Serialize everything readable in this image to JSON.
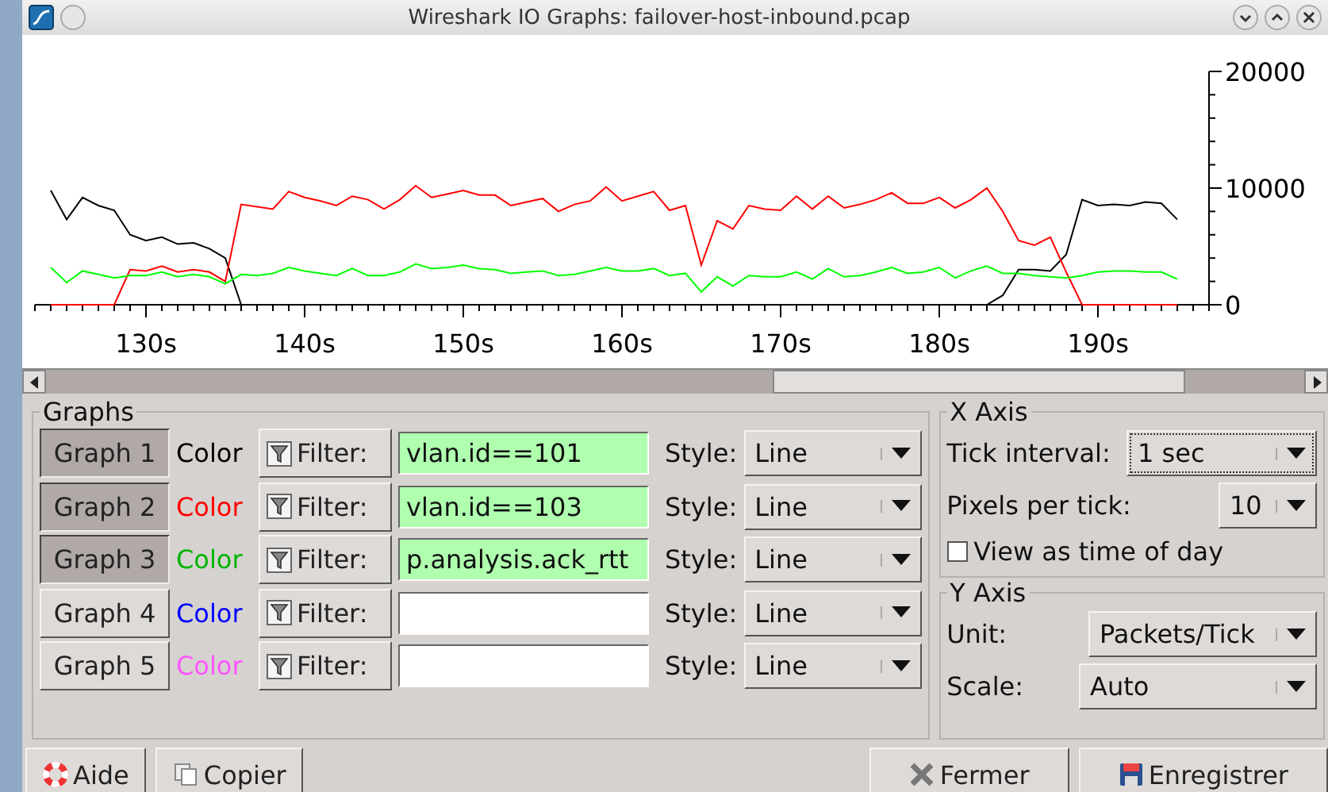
{
  "window": {
    "title": "Wireshark IO Graphs: failover-host-inbound.pcap"
  },
  "plot": {
    "chart_data": {
      "type": "line",
      "x": [
        124,
        125,
        126,
        127,
        128,
        129,
        130,
        131,
        132,
        133,
        134,
        135,
        136,
        137,
        138,
        139,
        140,
        141,
        142,
        143,
        144,
        145,
        146,
        147,
        148,
        149,
        150,
        151,
        152,
        153,
        154,
        155,
        156,
        157,
        158,
        159,
        160,
        161,
        162,
        163,
        164,
        165,
        166,
        167,
        168,
        169,
        170,
        171,
        172,
        173,
        174,
        175,
        176,
        177,
        178,
        179,
        180,
        181,
        182,
        183,
        184,
        185,
        186,
        187,
        188,
        189,
        190,
        191,
        192,
        193,
        194,
        195
      ],
      "xlim": [
        123,
        197
      ],
      "ylim": [
        0,
        20000
      ],
      "xticks": [
        {
          "value": 130,
          "label": "130s"
        },
        {
          "value": 140,
          "label": "140s"
        },
        {
          "value": 150,
          "label": "150s"
        },
        {
          "value": 160,
          "label": "160s"
        },
        {
          "value": 170,
          "label": "170s"
        },
        {
          "value": 180,
          "label": "180s"
        },
        {
          "value": 190,
          "label": "190s"
        }
      ],
      "yticks": [
        0,
        10000,
        20000
      ],
      "series": [
        {
          "color": "#000000",
          "values": [
            9800,
            7300,
            9200,
            8500,
            8100,
            6000,
            5500,
            5800,
            5200,
            5300,
            4800,
            4000,
            0,
            0,
            0,
            0,
            0,
            0,
            0,
            0,
            0,
            0,
            0,
            0,
            0,
            0,
            0,
            0,
            0,
            0,
            0,
            0,
            0,
            0,
            0,
            0,
            0,
            0,
            0,
            0,
            0,
            0,
            0,
            0,
            0,
            0,
            0,
            0,
            0,
            0,
            0,
            0,
            0,
            0,
            0,
            0,
            0,
            0,
            0,
            0,
            800,
            3000,
            3000,
            2900,
            4300,
            9000,
            8500,
            8600,
            8500,
            8800,
            8700,
            7300
          ]
        },
        {
          "color": "#ff0000",
          "values": [
            0,
            0,
            0,
            0,
            0,
            3000,
            2900,
            3300,
            2800,
            3000,
            2800,
            2000,
            8600,
            8400,
            8200,
            9700,
            9200,
            8900,
            8500,
            9300,
            9000,
            8200,
            9000,
            10200,
            9200,
            9500,
            9800,
            9400,
            9400,
            8500,
            8800,
            9100,
            8000,
            8600,
            8900,
            10100,
            8900,
            9300,
            9700,
            8100,
            8500,
            3400,
            7200,
            6500,
            8500,
            8200,
            8100,
            9300,
            8200,
            9300,
            8300,
            8600,
            9000,
            9600,
            8700,
            8700,
            9200,
            8300,
            9000,
            10000,
            8000,
            5500,
            5100,
            5800,
            2800,
            0,
            0,
            0,
            0,
            0,
            0,
            0
          ]
        },
        {
          "color": "#00ff00",
          "values": [
            3200,
            1900,
            2900,
            2600,
            2300,
            2500,
            2500,
            2800,
            2400,
            2600,
            2400,
            1800,
            2600,
            2500,
            2700,
            3200,
            2900,
            2700,
            2500,
            3100,
            2500,
            2500,
            2800,
            3500,
            3100,
            3200,
            3400,
            3100,
            3000,
            2700,
            2800,
            2900,
            2500,
            2600,
            2900,
            3200,
            2900,
            2900,
            3100,
            2500,
            2700,
            1100,
            2400,
            1600,
            2500,
            2400,
            2400,
            2800,
            2200,
            3100,
            2400,
            2500,
            2800,
            3200,
            2700,
            2800,
            3200,
            2300,
            2900,
            3300,
            2700,
            2700,
            2500,
            2400,
            2300,
            2500,
            2800,
            2900,
            2900,
            2800,
            2800,
            2200
          ]
        }
      ]
    }
  },
  "graphs": {
    "title": "Graphs",
    "rows": [
      {
        "label": "Graph 1",
        "selected": true,
        "color_label": "Color",
        "color": "#000000",
        "filter_button": "Filter:",
        "filter": "vlan.id==101",
        "style_label": "Style:",
        "style": "Line"
      },
      {
        "label": "Graph 2",
        "selected": true,
        "color_label": "Color",
        "color": "#ff0000",
        "filter_button": "Filter:",
        "filter": "vlan.id==103",
        "style_label": "Style:",
        "style": "Line"
      },
      {
        "label": "Graph 3",
        "selected": true,
        "color_label": "Color",
        "color": "#00b400",
        "filter_button": "Filter:",
        "filter": "p.analysis.ack_rtt",
        "style_label": "Style:",
        "style": "Line"
      },
      {
        "label": "Graph 4",
        "selected": false,
        "color_label": "Color",
        "color": "#0000ff",
        "filter_button": "Filter:",
        "style_label": "Style:",
        "style": "Line"
      },
      {
        "label": "Graph 5",
        "selected": false,
        "color_label": "Color",
        "color": "#ff55ff",
        "filter_button": "Filter:",
        "style_label": "Style:",
        "style": "Line"
      }
    ]
  },
  "x_axis": {
    "title": "X Axis",
    "tick_interval_label": "Tick interval:",
    "tick_interval": "1 sec",
    "pixels_label": "Pixels per tick:",
    "pixels": "10",
    "time_of_day": {
      "label": "View as time of day",
      "checked": false
    }
  },
  "y_axis": {
    "title": "Y Axis",
    "unit_label": "Unit:",
    "unit": "Packets/Tick",
    "scale_label": "Scale:",
    "scale": "Auto"
  },
  "buttons": [
    {
      "label": "Aide",
      "kind": "help"
    },
    {
      "label": "Copier",
      "kind": "copy"
    },
    {
      "label": "Fermer",
      "kind": "close"
    },
    {
      "label": "Enregistrer",
      "kind": "save"
    }
  ]
}
